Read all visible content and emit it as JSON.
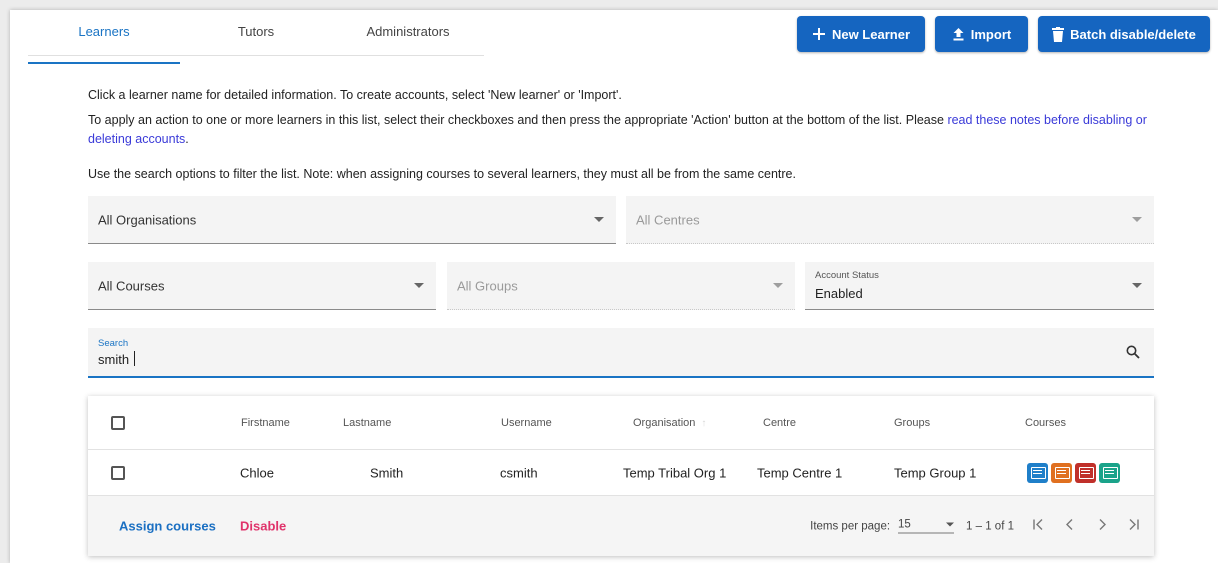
{
  "tabs": [
    {
      "label": "Learners",
      "active": true
    },
    {
      "label": "Tutors",
      "active": false
    },
    {
      "label": "Administrators",
      "active": false
    }
  ],
  "toolbar": {
    "new_learner": "New Learner",
    "import": "Import",
    "batch": "Batch disable/delete"
  },
  "info": {
    "line1": "Click a learner name for detailed information. To create accounts, select 'New learner' or 'Import'.",
    "line2_prefix": "To apply an action to one or more learners in this list, select their checkboxes and then press the appropriate 'Action' button at the bottom of the list. Please ",
    "line2_link": "read these notes before disabling or deleting accounts",
    "line2_suffix": ".",
    "line3": "Use the search options to filter the list. Note: when assigning courses to several learners, they must all be from the same centre."
  },
  "filters": {
    "organisations": "All Organisations",
    "centres": "All Centres",
    "courses": "All Courses",
    "groups": "All Groups",
    "status_label": "Account Status",
    "status_value": "Enabled"
  },
  "search": {
    "label": "Search",
    "value": "smith"
  },
  "table": {
    "columns": [
      "Firstname",
      "Lastname",
      "Username",
      "Organisation",
      "Centre",
      "Groups",
      "Courses"
    ],
    "rows": [
      {
        "firstname": "Chloe",
        "lastname": "Smith",
        "username": "csmith",
        "organisation": "Temp Tribal Org 1",
        "centre": "Temp Centre 1",
        "groups": "Temp Group 1"
      }
    ]
  },
  "course_icons": [
    {
      "name": "course-icon-blue",
      "color": "#1f7fc9"
    },
    {
      "name": "course-icon-orange",
      "color": "#e07020"
    },
    {
      "name": "course-icon-red",
      "color": "#c0302a"
    },
    {
      "name": "course-icon-teal",
      "color": "#1aa38a"
    }
  ],
  "footer": {
    "assign": "Assign courses",
    "disable": "Disable",
    "items_per_page_label": "Items per page:",
    "items_per_page": "15",
    "range": "1 – 1 of 1"
  },
  "colors": {
    "primary": "#1565c0",
    "link": "#1a74c4",
    "danger": "#e0336b"
  }
}
